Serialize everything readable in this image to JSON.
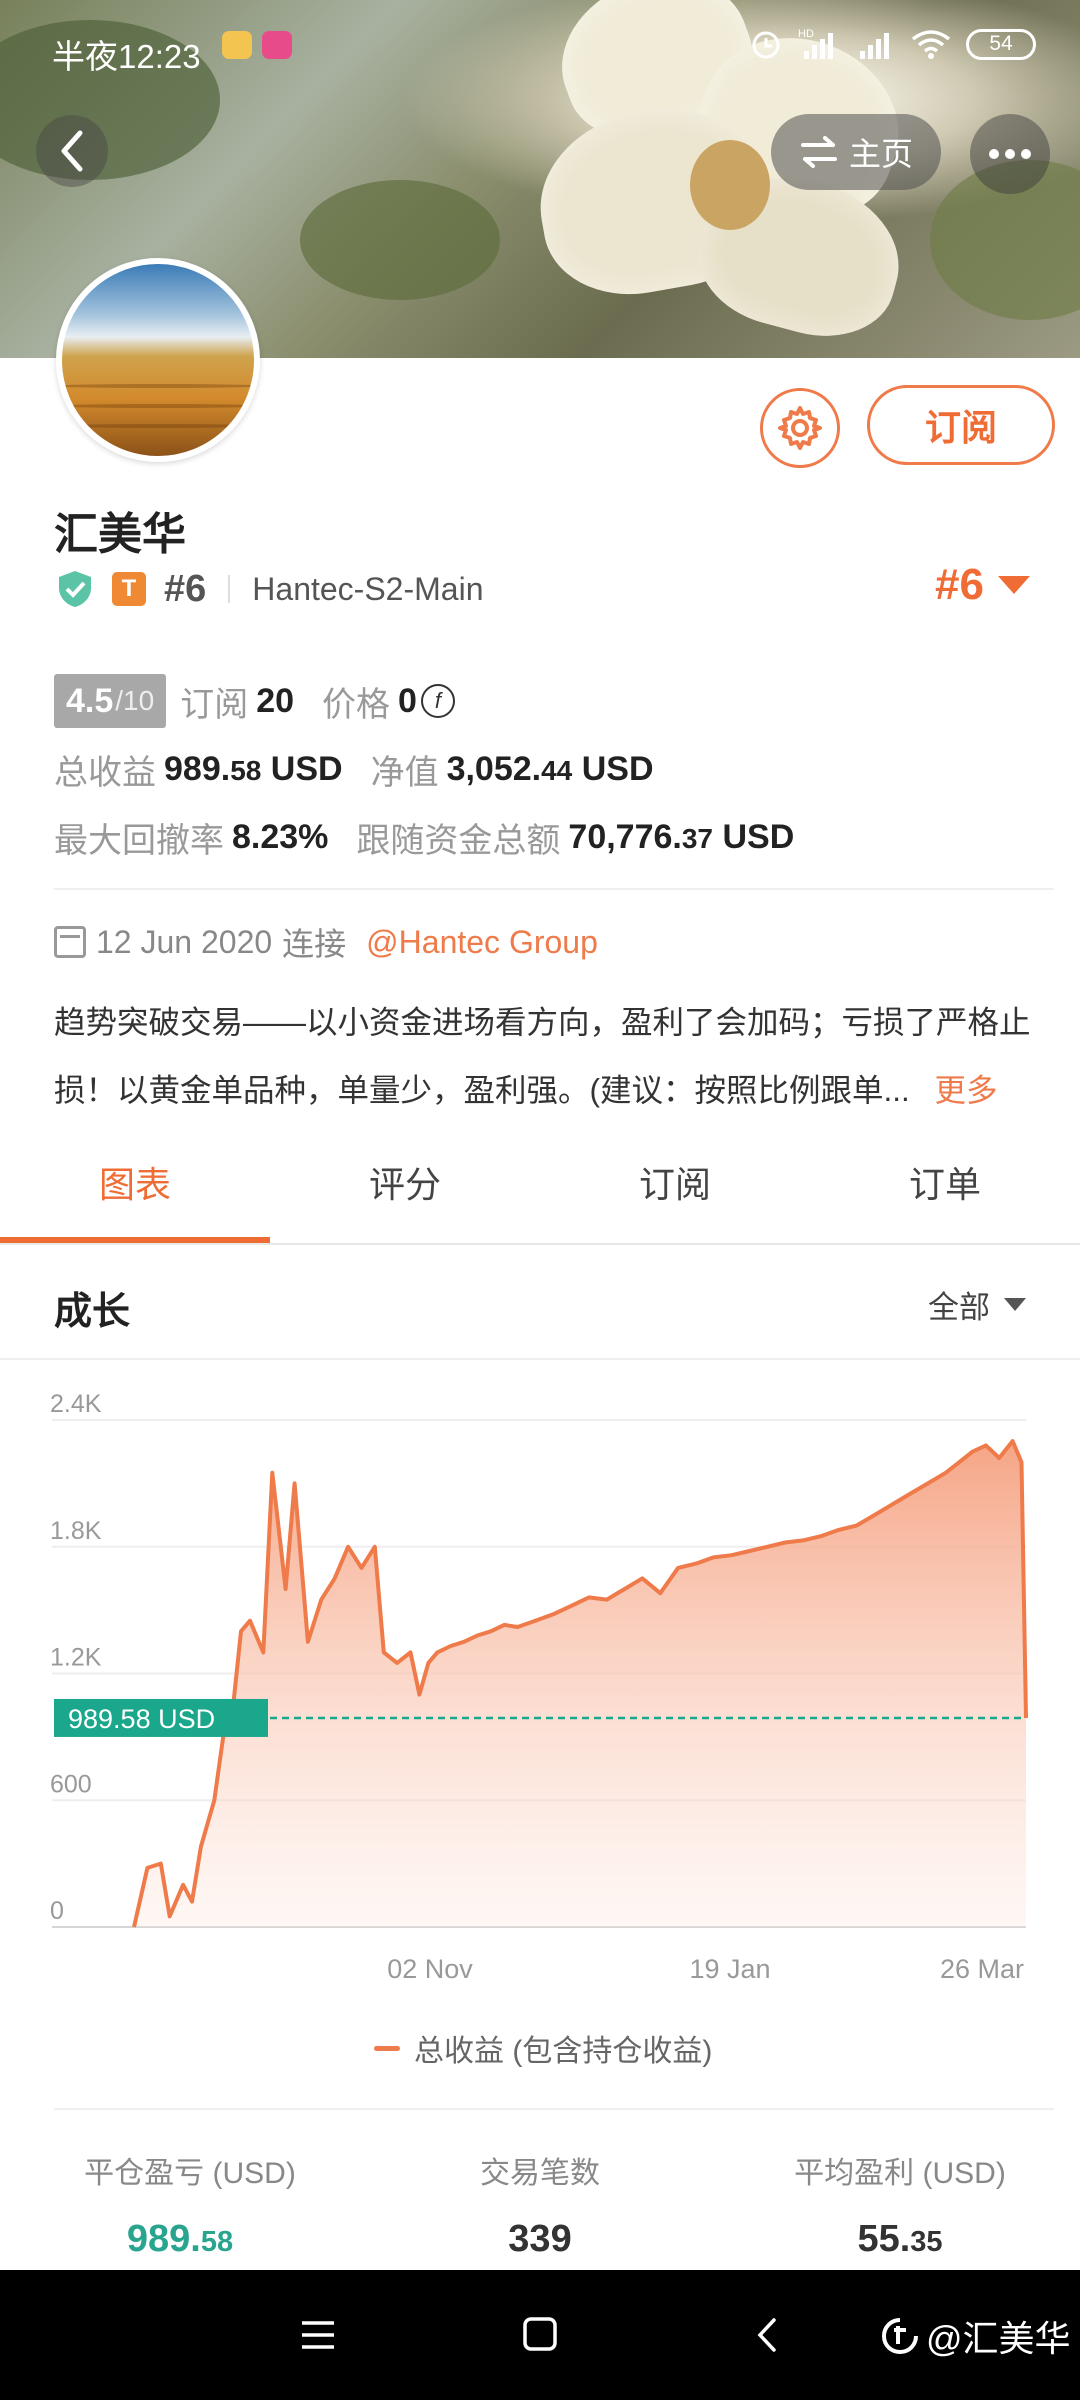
{
  "status_bar": {
    "time": "半夜12:23",
    "battery": "54"
  },
  "header": {
    "home_label": "主页"
  },
  "profile": {
    "name": "汇美华",
    "rank": "#6",
    "server": "Hantec-S2-Main",
    "rank_right": "#6",
    "subscribe_label": "订阅",
    "score": "4.5",
    "score_total": "/10",
    "subscribe_count_label": "订阅",
    "subscribe_count": "20",
    "price_label": "价格",
    "price": "0",
    "total_profit_label": "总收益",
    "total_profit_int": "989.",
    "total_profit_dec": "58",
    "total_profit_cur": " USD",
    "net_value_label": "净值",
    "net_value_int": "3,052.",
    "net_value_dec": "44",
    "net_value_cur": " USD",
    "max_drawdown_label": "最大回撤率",
    "max_drawdown": "8.23%",
    "follow_funds_label": "跟随资金总额",
    "follow_funds_int": "70,776.",
    "follow_funds_dec": "37",
    "follow_funds_cur": " USD",
    "since_date": "12 Jun 2020",
    "since_label": "连接",
    "broker_link": "@Hantec Group",
    "description": "趋势突破交易——以小资金进场看方向，盈利了会加码；亏损了严格止损！以黄金单品种，单量少，盈利强。(建议：按照比例跟单...",
    "more_label": "更多"
  },
  "tabs": [
    {
      "label": "图表"
    },
    {
      "label": "评分"
    },
    {
      "label": "订阅"
    },
    {
      "label": "订单"
    }
  ],
  "growth": {
    "title": "成长",
    "range_label": "全部"
  },
  "chart_data": {
    "type": "area",
    "yticks": [
      "2.4K",
      "1.8K",
      "1.2K",
      "600",
      "0"
    ],
    "ylim": [
      0,
      2400
    ],
    "xticks": [
      "02 Nov",
      "19 Jan",
      "26 Mar"
    ],
    "current_label": "989.58 USD",
    "current_value": 989.58,
    "series": [
      {
        "name": "总收益 (包含持仓收益)",
        "x": [
          0,
          1.5,
          3,
          4,
          5.5,
          6.5,
          7.5,
          9,
          10,
          11,
          12,
          13,
          14.5,
          15.5,
          17,
          18,
          19.5,
          21,
          22.5,
          24,
          25.5,
          27,
          28,
          29.5,
          31,
          32,
          33,
          34,
          35.5,
          37,
          38.5,
          40,
          41.5,
          43,
          45,
          47,
          49,
          51,
          53,
          55,
          57,
          59,
          61,
          63,
          65,
          67,
          69,
          71,
          73,
          75,
          77,
          79,
          81,
          83,
          85,
          87,
          89,
          91,
          92.5,
          94,
          95.5,
          97,
          98.5,
          99.5,
          100
        ],
        "values": [
          0,
          280,
          300,
          50,
          200,
          120,
          380,
          600,
          900,
          1000,
          1400,
          1450,
          1300,
          2150,
          1600,
          2100,
          1350,
          1550,
          1650,
          1800,
          1700,
          1800,
          1300,
          1250,
          1300,
          1100,
          1250,
          1300,
          1330,
          1350,
          1380,
          1400,
          1430,
          1420,
          1450,
          1480,
          1520,
          1560,
          1550,
          1600,
          1650,
          1580,
          1700,
          1720,
          1750,
          1760,
          1780,
          1800,
          1820,
          1830,
          1850,
          1880,
          1900,
          1950,
          2000,
          2050,
          2100,
          2150,
          2200,
          2250,
          2280,
          2220,
          2300,
          2200,
          989.58
        ]
      }
    ]
  },
  "summary": {
    "closed_pnl_label": "平仓盈亏 (USD)",
    "closed_pnl_int": "989.",
    "closed_pnl_dec": "58",
    "trades_label": "交易笔数",
    "trades": "339",
    "avg_profit_label": "平均盈利 (USD)",
    "avg_profit_int": "55.",
    "avg_profit_dec": "35"
  },
  "watermark": "@汇美华"
}
